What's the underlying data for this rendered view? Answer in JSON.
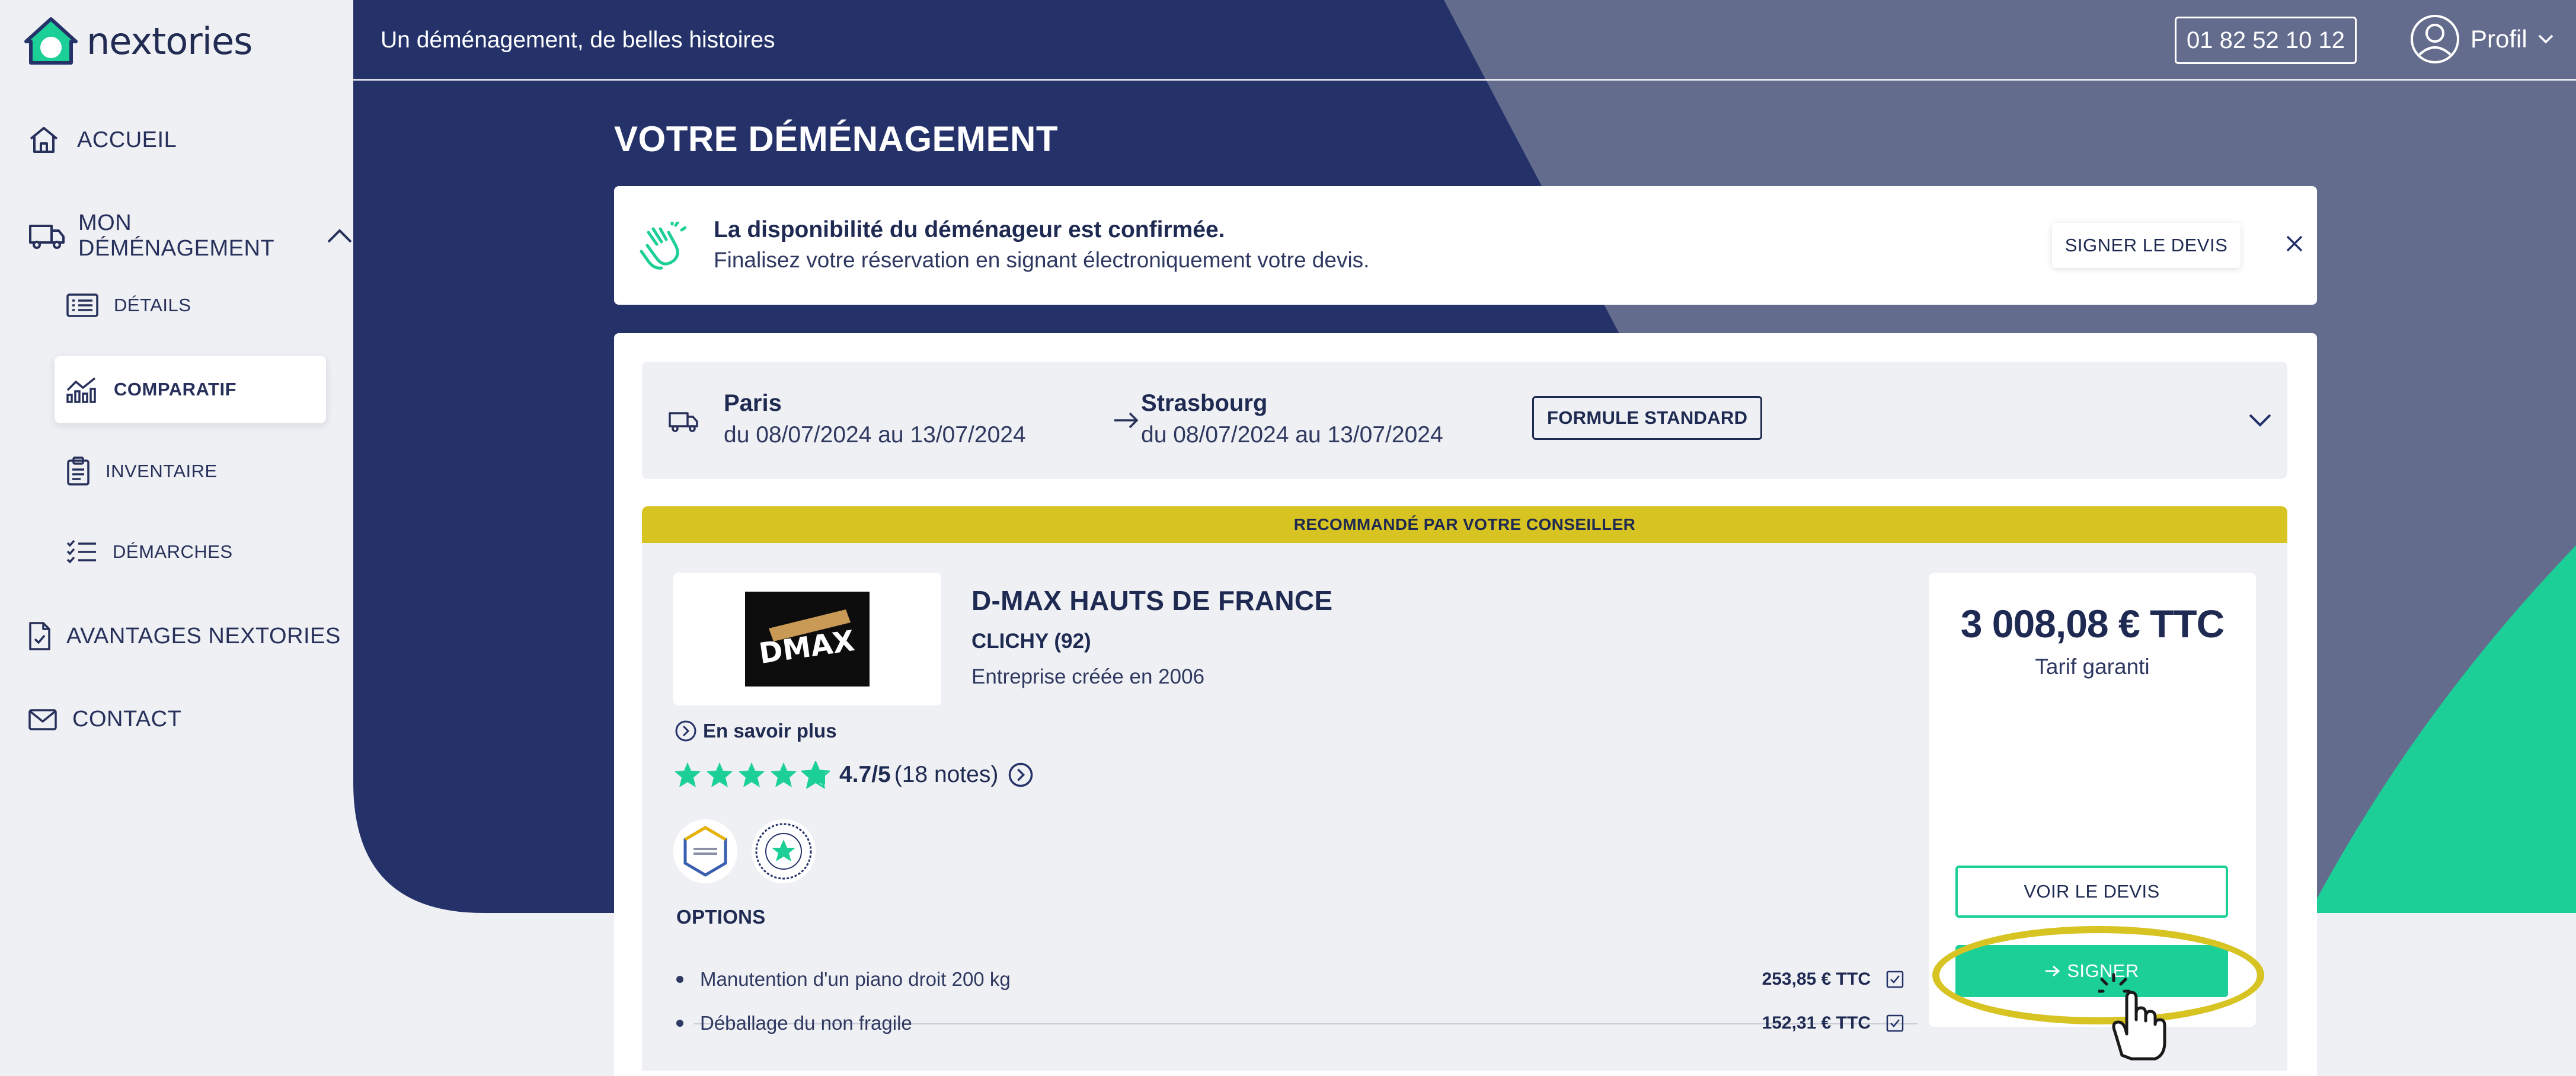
{
  "app": {
    "logo_text": "nextories",
    "tagline": "Un déménagement, de belles histoires"
  },
  "header": {
    "phone": "01 82 52 10 12",
    "profile_label": "Profil"
  },
  "sidebar": {
    "items": [
      {
        "label": "ACCUEIL",
        "icon": "home-icon"
      },
      {
        "label": "MON DÉMÉNAGEMENT",
        "icon": "truck-icon"
      },
      {
        "label": "DÉTAILS",
        "icon": "list-icon"
      },
      {
        "label": "COMPARATIF",
        "icon": "chart-icon",
        "active": true
      },
      {
        "label": "INVENTAIRE",
        "icon": "clipboard-icon"
      },
      {
        "label": "DÉMARCHES",
        "icon": "checklist-icon"
      },
      {
        "label": "AVANTAGES NEXTORIES",
        "icon": "document-icon"
      },
      {
        "label": "CONTACT",
        "icon": "mail-icon"
      }
    ]
  },
  "page": {
    "title": "VOTRE DÉMÉNAGEMENT"
  },
  "notice": {
    "title": "La disponibilité du déménageur est confirmée.",
    "subtitle": "Finalisez votre réservation en signant électroniquement votre devis.",
    "button_label": "SIGNER LE DEVIS"
  },
  "route": {
    "from_city": "Paris",
    "from_dates": "du 08/07/2024 au 13/07/2024",
    "to_city": "Strasbourg",
    "to_dates": "du 08/07/2024 au 13/07/2024",
    "formula": "FORMULE STANDARD"
  },
  "offer": {
    "recommendation": "RECOMMANDÉ PAR VOTRE CONSEILLER",
    "logo_text": "DMAX",
    "mover_name": "D-MAX HAUTS DE FRANCE",
    "mover_city": "CLICHY (92)",
    "founded": "Entreprise créée en 2006",
    "learn_more": "En savoir plus",
    "rating_score": "4.7/5",
    "rating_count": "(18 notes)",
    "rating_value": 4.7,
    "options_title": "OPTIONS",
    "options": [
      {
        "label": "Manutention d'un piano droit 200 kg",
        "price": "253,85 € TTC"
      },
      {
        "label": "Déballage du non fragile",
        "price": "152,31 € TTC"
      }
    ],
    "price": "3 008,08 € TTC",
    "price_note": "Tarif garanti",
    "view_quote_label": "VOIR LE DEVIS",
    "sign_label": "SIGNER"
  },
  "colors": {
    "navy": "#25326a",
    "slate": "#646c8e",
    "green": "#1ccf97",
    "gold": "#d7c321",
    "sidebar_bg": "#eef0f3"
  }
}
